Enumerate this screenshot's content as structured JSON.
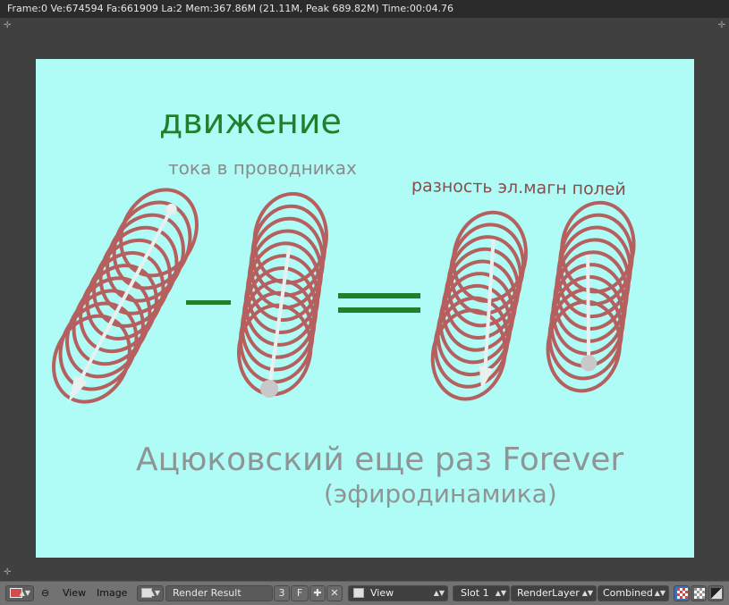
{
  "status": {
    "text": "Frame:0 Ve:674594 Fa:661909 La:2 Mem:367.86M (21.11M, Peak 689.82M) Time:00:04.76"
  },
  "render": {
    "title": "движение",
    "subtitle": "тока в проводниках",
    "subtitle_right": "разность эл.магн полей",
    "caption_main": "Ацюковский еще раз Forever",
    "caption_sub": "(эфиродинамика)",
    "colors": {
      "background": "#aefcf5",
      "title": "#1f7f2c",
      "coil": "#b5605f",
      "arrow": "#e8f0f0"
    }
  },
  "footer": {
    "menu_view": "View",
    "menu_image": "Image",
    "image_name": "Render Result",
    "users_count": "3",
    "fake_user": "F",
    "view_mode": "View",
    "slot": "Slot 1",
    "layer": "RenderLayer",
    "pass": "Combined"
  },
  "icons": {
    "editor_type": "image-editor-icon",
    "collapse": "collapse-menu-icon",
    "browse_image": "image-browse-icon",
    "new_image": "plus-icon",
    "unlink": "close-icon",
    "view_icon": "view-mode-icon",
    "alpha1": "checker-icon",
    "alpha2": "checker-small-icon",
    "alpha3": "alpha-diagonal-icon"
  }
}
